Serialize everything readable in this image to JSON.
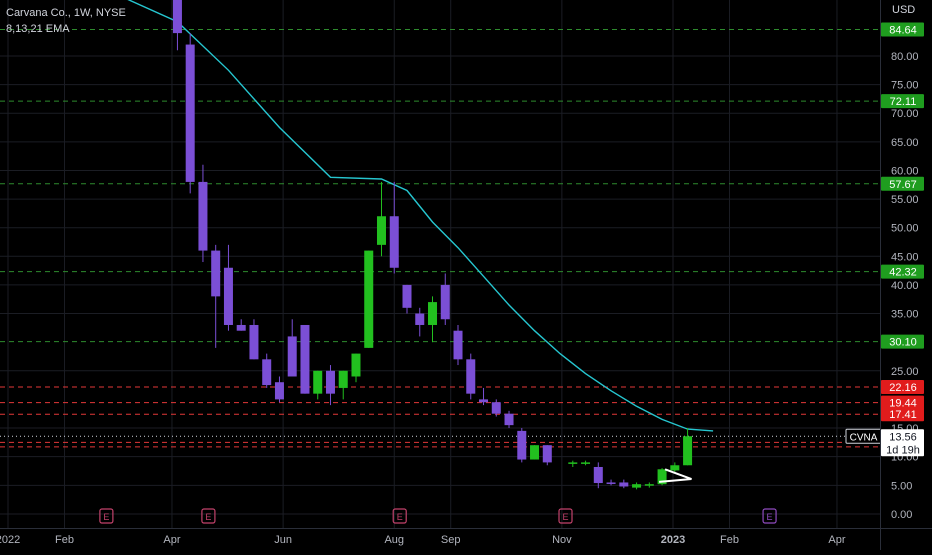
{
  "header": {
    "title": "Carvana Co., 1W, NYSE",
    "indicator": "8,13,21 EMA",
    "currency": "USD"
  },
  "colors": {
    "background": "#000000",
    "up": "#22c01f",
    "down": "#7b4fd6",
    "ema": "#26c6d0",
    "green_line": "#2e8b2e",
    "red_line": "#e33838",
    "grid": "#1b1d24",
    "earnings": "#c2426b",
    "earnings_upcoming": "#8f4bbf"
  },
  "chart_data": {
    "type": "candlestick",
    "symbol": "CVNA",
    "y_axis_ticks": [
      "0.00",
      "5.00",
      "10.00",
      "15.00",
      "25.00",
      "35.00",
      "40.00",
      "45.00",
      "50.00",
      "55.00",
      "60.00",
      "65.00",
      "70.00",
      "75.00",
      "80.00"
    ],
    "x_axis_ticks": [
      "2022",
      "Feb",
      "Apr",
      "Jun",
      "Aug",
      "Sep",
      "Nov",
      "2023",
      "Feb",
      "Apr"
    ],
    "ylim": [
      0,
      88
    ],
    "green_levels": [
      84.64,
      72.11,
      57.67,
      42.32,
      30.1
    ],
    "red_levels": [
      22.16,
      19.44,
      17.41,
      12.5,
      11.7
    ],
    "last_price": {
      "label": "CVNA",
      "value": "13.56",
      "countdown": "1d 19h"
    },
    "earnings_markers": [
      "E",
      "E",
      "E",
      "E",
      "E"
    ],
    "ema_series": {
      "x": [
        "2022-03-07",
        "2022-04-04",
        "2022-05-02",
        "2022-05-30",
        "2022-06-27",
        "2022-07-25",
        "2022-08-08",
        "2022-08-22",
        "2022-09-05",
        "2022-09-19",
        "2022-10-03",
        "2022-10-17",
        "2022-10-31",
        "2022-11-14",
        "2022-11-28",
        "2022-12-12",
        "2022-12-26",
        "2023-01-09",
        "2023-01-23"
      ],
      "y": [
        90,
        86,
        77.5,
        67.5,
        58.8,
        58.5,
        56.5,
        51,
        46.5,
        41.5,
        36.5,
        32,
        28,
        24.5,
        21.5,
        18.8,
        16.5,
        14.8,
        14.5
      ]
    },
    "candles": [
      {
        "date": "2022-04-04",
        "open": 91,
        "high": 96,
        "low": 81,
        "close": 84
      },
      {
        "date": "2022-04-11",
        "open": 82,
        "high": 84,
        "low": 56,
        "close": 58
      },
      {
        "date": "2022-04-18",
        "open": 58,
        "high": 61,
        "low": 44,
        "close": 46
      },
      {
        "date": "2022-04-25",
        "open": 46,
        "high": 47,
        "low": 29,
        "close": 38
      },
      {
        "date": "2022-05-02",
        "open": 43,
        "high": 47,
        "low": 32,
        "close": 33
      },
      {
        "date": "2022-05-09",
        "open": 33,
        "high": 34,
        "low": 32,
        "close": 32
      },
      {
        "date": "2022-05-16",
        "open": 33,
        "high": 34,
        "low": 27,
        "close": 27
      },
      {
        "date": "2022-05-23",
        "open": 27,
        "high": 28,
        "low": 22,
        "close": 22.5
      },
      {
        "date": "2022-05-30",
        "open": 23,
        "high": 24,
        "low": 19.5,
        "close": 20
      },
      {
        "date": "2022-06-06",
        "open": 31,
        "high": 34,
        "low": 31,
        "close": 24
      },
      {
        "date": "2022-06-13",
        "open": 33,
        "high": 33,
        "low": 21,
        "close": 21
      },
      {
        "date": "2022-06-20",
        "open": 21,
        "high": 25,
        "low": 20,
        "close": 25
      },
      {
        "date": "2022-06-27",
        "open": 25,
        "high": 26,
        "low": 19,
        "close": 21
      },
      {
        "date": "2022-07-04",
        "open": 22,
        "high": 25,
        "low": 20,
        "close": 25
      },
      {
        "date": "2022-07-11",
        "open": 24,
        "high": 28,
        "low": 23,
        "close": 28
      },
      {
        "date": "2022-07-18",
        "open": 29,
        "high": 46,
        "low": 29,
        "close": 46
      },
      {
        "date": "2022-07-25",
        "open": 47,
        "high": 58,
        "low": 45,
        "close": 52
      },
      {
        "date": "2022-08-01",
        "open": 52,
        "high": 58,
        "low": 42,
        "close": 43
      },
      {
        "date": "2022-08-08",
        "open": 40,
        "high": 40,
        "low": 35,
        "close": 36
      },
      {
        "date": "2022-08-15",
        "open": 35,
        "high": 36,
        "low": 31,
        "close": 33
      },
      {
        "date": "2022-08-22",
        "open": 33,
        "high": 38,
        "low": 30,
        "close": 37
      },
      {
        "date": "2022-08-29",
        "open": 40,
        "high": 42,
        "low": 33,
        "close": 34
      },
      {
        "date": "2022-09-05",
        "open": 32,
        "high": 33,
        "low": 26,
        "close": 27
      },
      {
        "date": "2022-09-12",
        "open": 27,
        "high": 28,
        "low": 20,
        "close": 21
      },
      {
        "date": "2022-09-19",
        "open": 20,
        "high": 22,
        "low": 19,
        "close": 19.5
      },
      {
        "date": "2022-09-26",
        "open": 19.5,
        "high": 20,
        "low": 17,
        "close": 17.5
      },
      {
        "date": "2022-10-03",
        "open": 17.5,
        "high": 18,
        "low": 15,
        "close": 15.5
      },
      {
        "date": "2022-10-10",
        "open": 14.5,
        "high": 15,
        "low": 9,
        "close": 9.5
      },
      {
        "date": "2022-10-17",
        "open": 9.5,
        "high": 12,
        "low": 9.5,
        "close": 12
      },
      {
        "date": "2022-10-24",
        "open": 12,
        "high": 12,
        "low": 8.5,
        "close": 9
      },
      {
        "date": "2022-11-07",
        "open": 8.8,
        "high": 9.3,
        "low": 8.2,
        "close": 9
      },
      {
        "date": "2022-11-14",
        "open": 8.8,
        "high": 9.3,
        "low": 8.5,
        "close": 9
      },
      {
        "date": "2022-11-21",
        "open": 8.2,
        "high": 9,
        "low": 4.5,
        "close": 5.4
      },
      {
        "date": "2022-11-28",
        "open": 5.5,
        "high": 6,
        "low": 5,
        "close": 5.4
      },
      {
        "date": "2022-12-05",
        "open": 5.5,
        "high": 6,
        "low": 4.5,
        "close": 4.8
      },
      {
        "date": "2022-12-12",
        "open": 4.6,
        "high": 5.5,
        "low": 4.3,
        "close": 5.2
      },
      {
        "date": "2022-12-19",
        "open": 5,
        "high": 5.5,
        "low": 4.6,
        "close": 5.2
      },
      {
        "date": "2022-12-26",
        "open": 5.2,
        "high": 8,
        "low": 5,
        "close": 7.8
      },
      {
        "date": "2023-01-02",
        "open": 7.6,
        "high": 9,
        "low": 7.3,
        "close": 8.5
      },
      {
        "date": "2023-01-09",
        "open": 8.5,
        "high": 15,
        "low": 8.5,
        "close": 13.56
      }
    ]
  }
}
